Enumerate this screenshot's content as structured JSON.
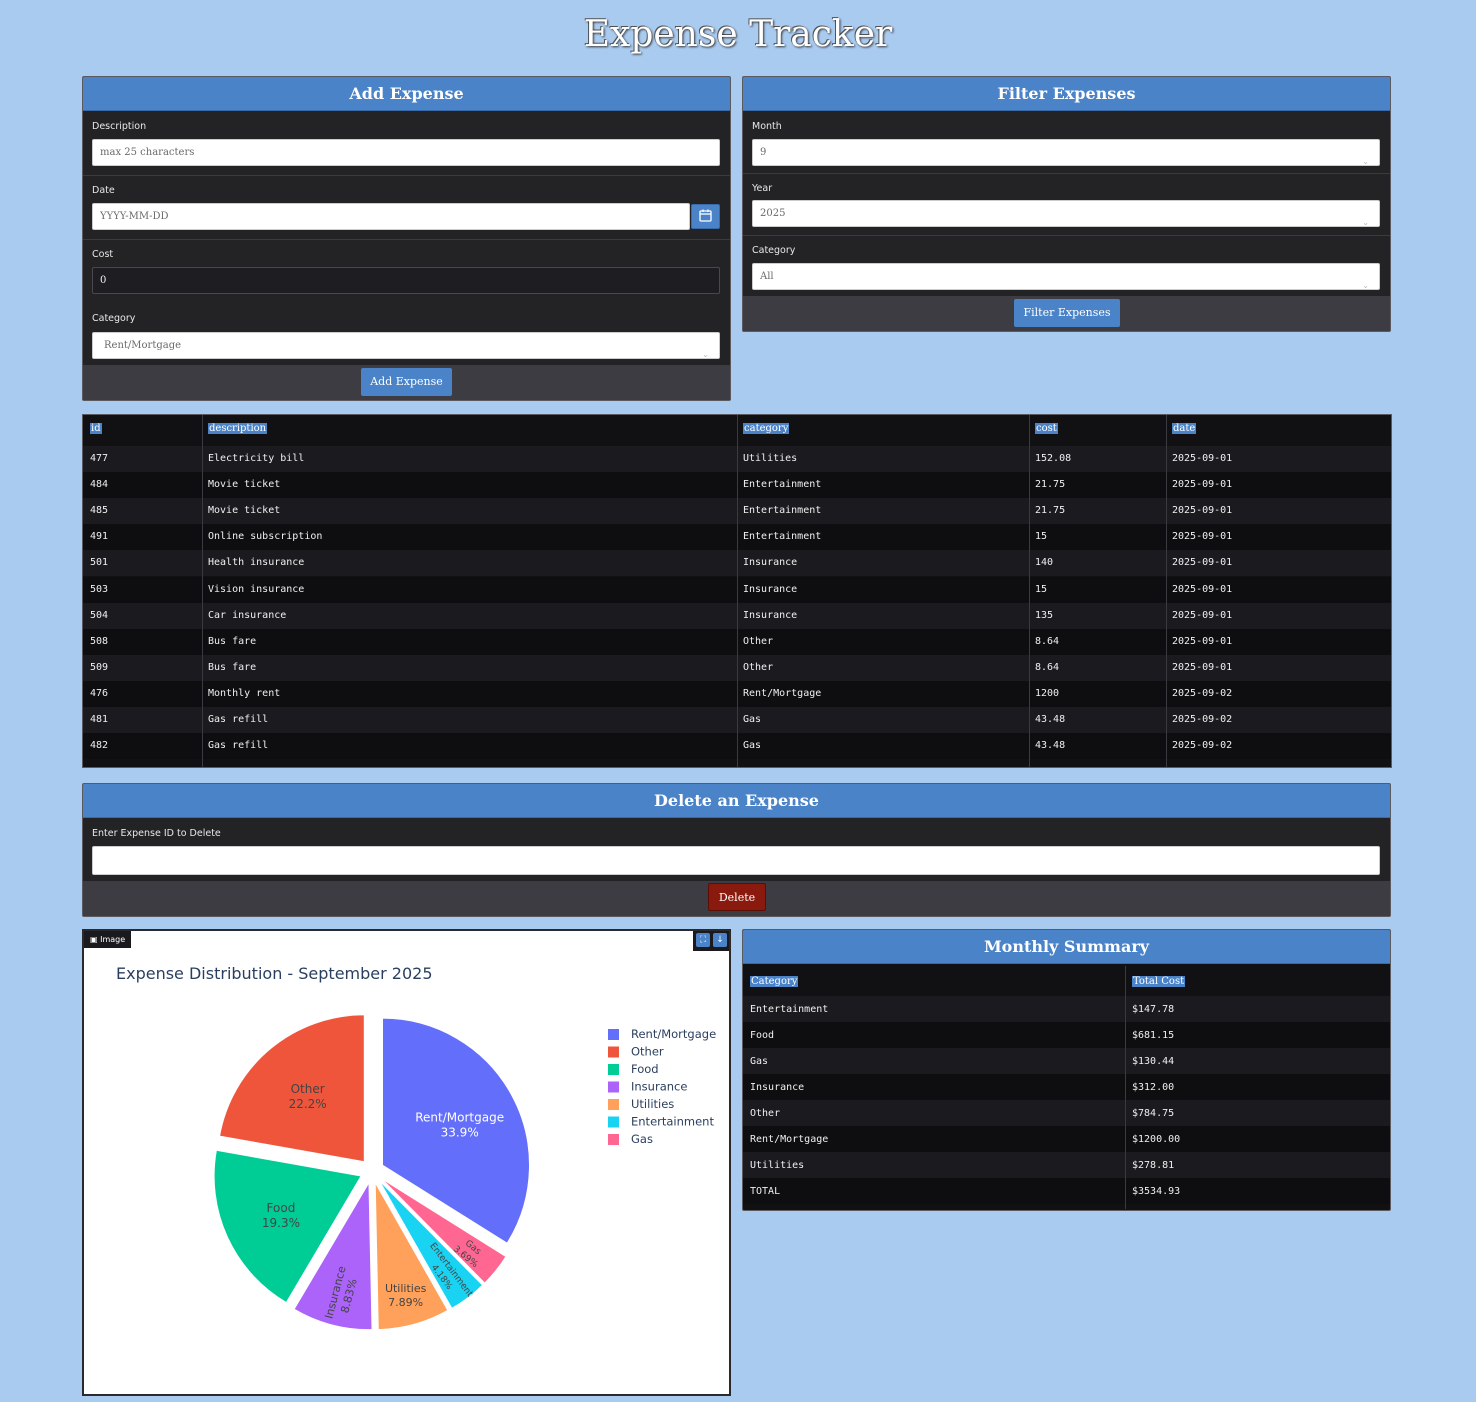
{
  "app": {
    "title": "Expense Tracker"
  },
  "add_expense": {
    "title": "Add Expense",
    "description_label": "Description",
    "description_placeholder": "max 25 characters",
    "date_label": "Date",
    "date_placeholder": "YYYY-MM-DD",
    "cost_label": "Cost",
    "cost_value": "0",
    "category_label": "Category",
    "category_value": "Rent/Mortgage",
    "button_label": "Add Expense"
  },
  "filter": {
    "title": "Filter Expenses",
    "month_label": "Month",
    "month_value": "9",
    "year_label": "Year",
    "year_value": "2025",
    "category_label": "Category",
    "category_value": "All",
    "button_label": "Filter Expenses"
  },
  "expenses_table": {
    "columns": [
      "id",
      "description",
      "category",
      "cost",
      "date"
    ],
    "rows": [
      [
        "477",
        "Electricity bill",
        "Utilities",
        "152.08",
        "2025-09-01"
      ],
      [
        "484",
        "Movie ticket",
        "Entertainment",
        "21.75",
        "2025-09-01"
      ],
      [
        "485",
        "Movie ticket",
        "Entertainment",
        "21.75",
        "2025-09-01"
      ],
      [
        "491",
        "Online subscription",
        "Entertainment",
        "15",
        "2025-09-01"
      ],
      [
        "501",
        "Health insurance",
        "Insurance",
        "140",
        "2025-09-01"
      ],
      [
        "503",
        "Vision insurance",
        "Insurance",
        "15",
        "2025-09-01"
      ],
      [
        "504",
        "Car insurance",
        "Insurance",
        "135",
        "2025-09-01"
      ],
      [
        "508",
        "Bus fare",
        "Other",
        "8.64",
        "2025-09-01"
      ],
      [
        "509",
        "Bus fare",
        "Other",
        "8.64",
        "2025-09-01"
      ],
      [
        "476",
        "Monthly rent",
        "Rent/Mortgage",
        "1200",
        "2025-09-02"
      ],
      [
        "481",
        "Gas refill",
        "Gas",
        "43.48",
        "2025-09-02"
      ],
      [
        "482",
        "Gas refill",
        "Gas",
        "43.48",
        "2025-09-02"
      ]
    ]
  },
  "delete": {
    "title": "Delete an Expense",
    "label": "Enter Expense ID to Delete",
    "value": "",
    "button_label": "Delete"
  },
  "image_panel": {
    "tag_label": "Image"
  },
  "chart_data": {
    "type": "pie",
    "title": "Expense Distribution - September 2025",
    "slices": [
      {
        "label": "Rent/Mortgage",
        "value": 33.9,
        "text": "33.9%",
        "color": "#636efa"
      },
      {
        "label": "Gas",
        "value": 3.69,
        "text": "3.69%",
        "color": "#ff6692"
      },
      {
        "label": "Entertainment",
        "value": 4.18,
        "text": "4.18%",
        "color": "#19d3f3"
      },
      {
        "label": "Utilities",
        "value": 7.89,
        "text": "7.89%",
        "color": "#ffa15a"
      },
      {
        "label": "Insurance",
        "value": 8.83,
        "text": "8.83%",
        "color": "#ab63fa"
      },
      {
        "label": "Food",
        "value": 19.3,
        "text": "19.3%",
        "color": "#00cc96"
      },
      {
        "label": "Other",
        "value": 22.2,
        "text": "22.2%",
        "color": "#ef553b"
      }
    ],
    "legend": [
      "Rent/Mortgage",
      "Other",
      "Food",
      "Insurance",
      "Utilities",
      "Entertainment",
      "Gas"
    ],
    "legend_placement": "right"
  },
  "summary": {
    "title": "Monthly Summary",
    "columns": [
      "Category",
      "Total Cost"
    ],
    "rows": [
      [
        "Entertainment",
        "$147.78"
      ],
      [
        "Food",
        "$681.15"
      ],
      [
        "Gas",
        "$130.44"
      ],
      [
        "Insurance",
        "$312.00"
      ],
      [
        "Other",
        "$784.75"
      ],
      [
        "Rent/Mortgage",
        "$1200.00"
      ],
      [
        "Utilities",
        "$278.81"
      ],
      [
        "TOTAL",
        "$3534.93"
      ]
    ]
  }
}
